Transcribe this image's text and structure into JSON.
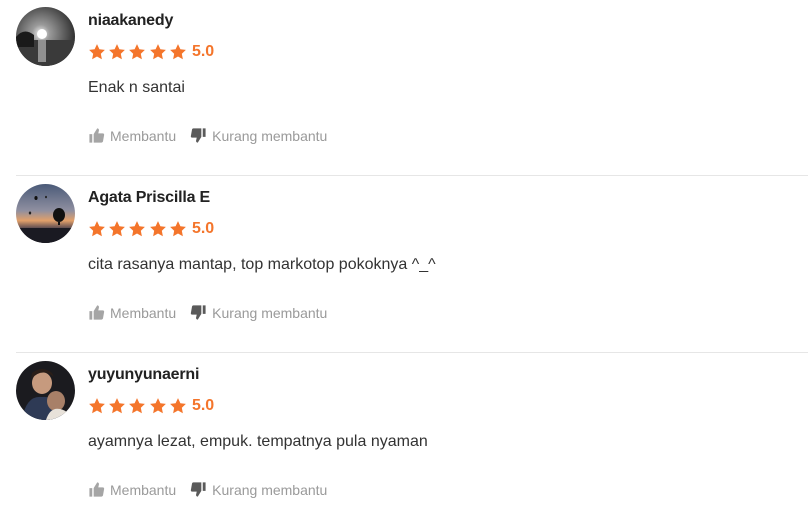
{
  "accent_color": "#f4752b",
  "reviews": [
    {
      "username": "niaakanedy",
      "rating": 5,
      "rating_label": "5.0",
      "comment": "Enak n santai",
      "helpful_label": "Membantu",
      "not_helpful_label": "Kurang membantu"
    },
    {
      "username": "Agata Priscilla E",
      "rating": 5,
      "rating_label": "5.0",
      "comment": "cita rasanya mantap, top markotop pokoknya ^_^",
      "helpful_label": "Membantu",
      "not_helpful_label": "Kurang membantu"
    },
    {
      "username": "yuyunyunaerni",
      "rating": 5,
      "rating_label": "5.0",
      "comment": "ayamnya lezat, empuk. tempatnya pula nyaman",
      "helpful_label": "Membantu",
      "not_helpful_label": "Kurang membantu"
    }
  ]
}
